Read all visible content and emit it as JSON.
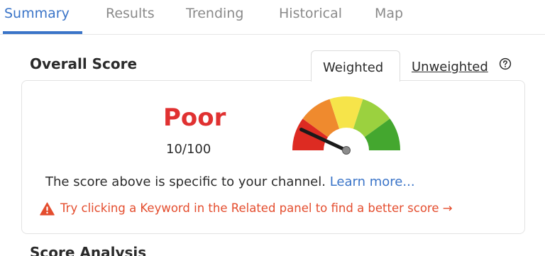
{
  "tabs": [
    {
      "label": "Summary",
      "active": true
    },
    {
      "label": "Results",
      "active": false
    },
    {
      "label": "Trending",
      "active": false
    },
    {
      "label": "Historical",
      "active": false
    },
    {
      "label": "Map",
      "active": false
    }
  ],
  "overall": {
    "title": "Overall Score",
    "weighted_label": "Weighted",
    "unweighted_label": "Unweighted",
    "rating": "Poor",
    "score_text": "10/100",
    "score_value": 10,
    "score_max": 100,
    "description": "The score above is specific to your channel.",
    "learn_more": "Learn more...",
    "warning": "Try clicking a Keyword in the Related panel to find a better score →"
  },
  "next_section": {
    "title": "Score Analysis"
  },
  "colors": {
    "accent": "#3a74c8",
    "poor": "#e03131",
    "warning": "#e44d2e",
    "gauge": [
      "#dd2b22",
      "#ef8a2e",
      "#f6e44a",
      "#9bd13f",
      "#44a72f"
    ]
  },
  "icons": {
    "help": "help-circle-icon",
    "warning": "warning-triangle-icon",
    "gauge": "gauge-meter"
  }
}
